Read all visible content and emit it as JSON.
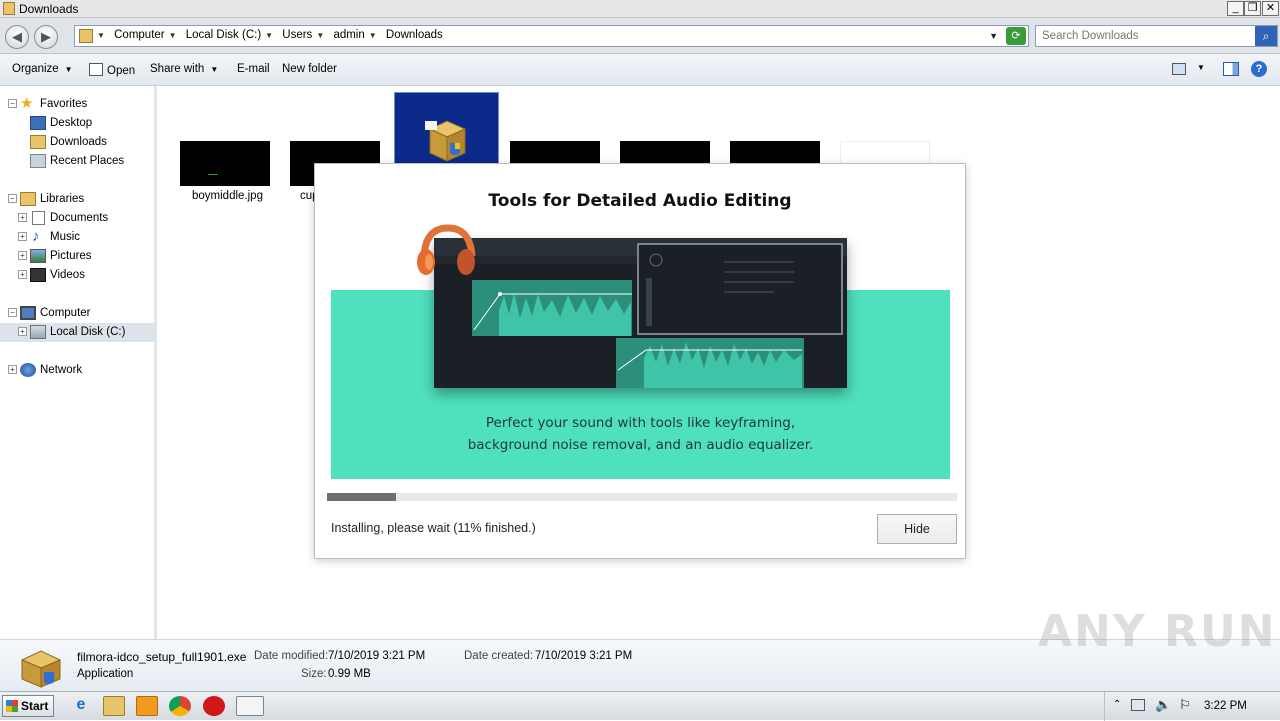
{
  "window": {
    "title": "Downloads",
    "min": "_",
    "max": "❐",
    "close": "✕"
  },
  "address": {
    "crumbs": [
      "Computer",
      "Local Disk (C:)",
      "Users",
      "admin",
      "Downloads"
    ],
    "search_placeholder": "Search Downloads"
  },
  "toolbar": {
    "organize": "Organize",
    "open": "Open",
    "share_with": "Share with",
    "email": "E-mail",
    "new_folder": "New folder"
  },
  "nav": {
    "favorites": "Favorites",
    "desktop": "Desktop",
    "downloads": "Downloads",
    "recent": "Recent Places",
    "libraries": "Libraries",
    "documents": "Documents",
    "music": "Music",
    "pictures": "Pictures",
    "videos": "Videos",
    "computer": "Computer",
    "local_disk": "Local Disk (C:)",
    "network": "Network"
  },
  "files": [
    {
      "label": "boymiddle.jpg"
    },
    {
      "label": "cup"
    }
  ],
  "installer": {
    "title": "Tools for Detailed Audio Editing",
    "description_line1": "Perfect your sound with tools like keyframing,",
    "description_line2": "background noise removal, and an audio equalizer.",
    "progress_percent": 11,
    "status": "Installing, please wait (11% finished.)",
    "hide_label": "Hide",
    "accent_color": "#4fe0bd"
  },
  "details": {
    "filename": "filmora-idco_setup_full1901.exe",
    "type": "Application",
    "modified_label": "Date modified:",
    "modified_value": "7/10/2019 3:21 PM",
    "created_label": "Date created:",
    "created_value": "7/10/2019 3:21 PM",
    "size_label": "Size:",
    "size_value": "0.99 MB"
  },
  "watermark": "ANY RUN",
  "taskbar": {
    "start": "Start",
    "clock": "3:22 PM"
  }
}
